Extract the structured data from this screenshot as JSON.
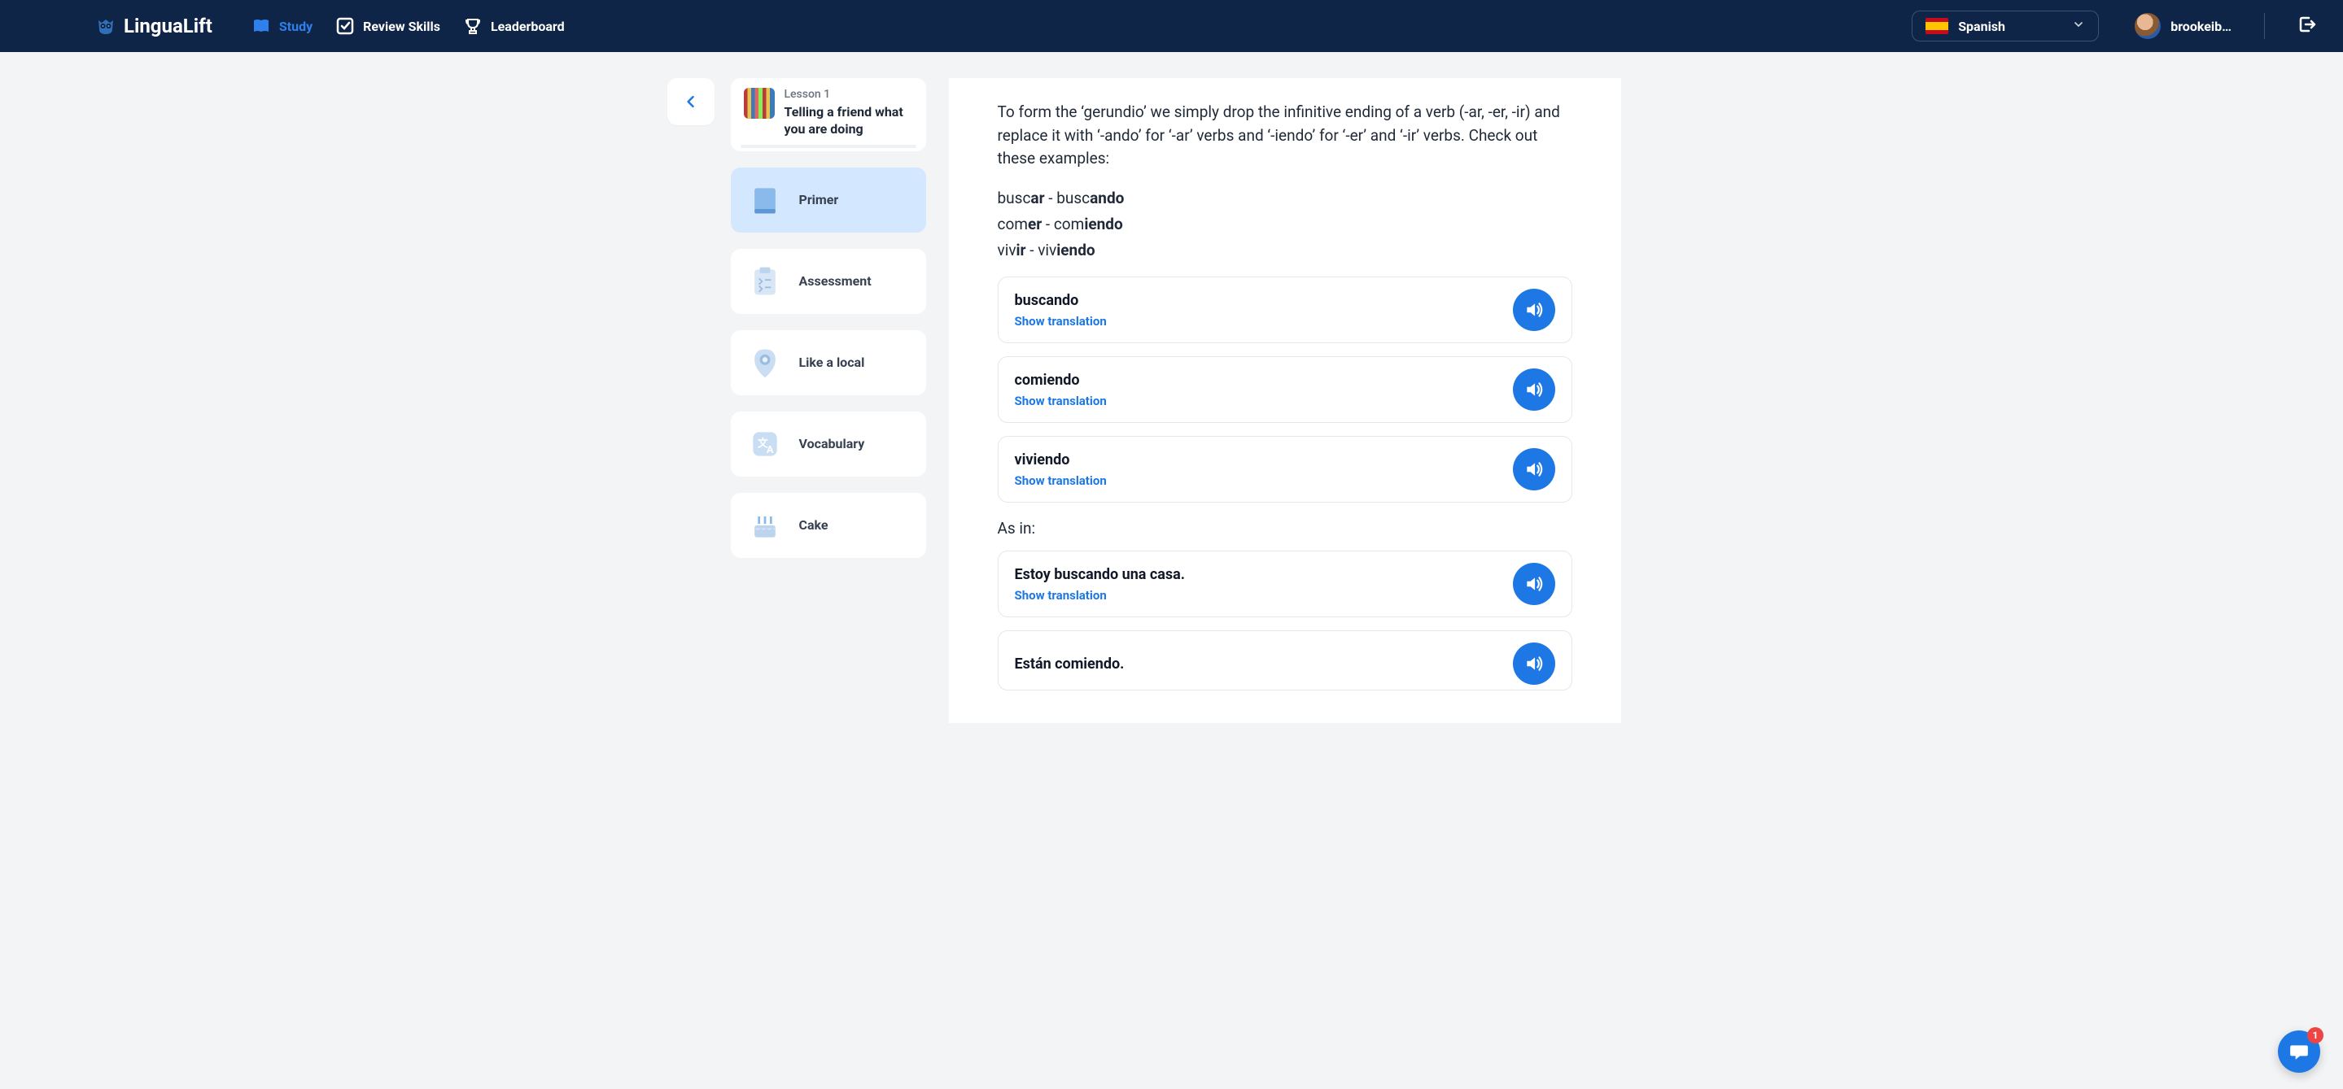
{
  "brand": {
    "name": "LinguaLift"
  },
  "nav": {
    "study": "Study",
    "review": "Review Skills",
    "leaderboard": "Leaderboard"
  },
  "language": {
    "label": "Spanish"
  },
  "user": {
    "name": "brookeib…"
  },
  "lesson": {
    "number": "Lesson 1",
    "title": "Telling a friend what you are doing"
  },
  "sidebar": {
    "primer": "Primer",
    "assessment": "Assessment",
    "likeLocal": "Like a local",
    "vocabulary": "Vocabulary",
    "cake": "Cake"
  },
  "content": {
    "intro": "To form the ‘gerundio’ we simply drop the infinitive ending of a verb (-ar, -er, -ir) and replace it with ‘-ando’ for ‘-ar’ verbs and ‘-iendo’ for ‘-er’ and ‘-ir’ verbs. Check out these examples:",
    "examples": {
      "l1": {
        "p1": "busc",
        "b1": "ar",
        "sep": " - ",
        "p2": "busc",
        "b2": "ando"
      },
      "l2": {
        "p1": "com",
        "b1": "er",
        "sep": " - ",
        "p2": "com",
        "b2": "iendo"
      },
      "l3": {
        "p1": "viv",
        "b1": "ir",
        "sep": " - ",
        "p2": "viv",
        "b2": "iendo"
      }
    },
    "showTranslation": "Show translation",
    "asIn": "As in:",
    "cards": [
      {
        "word": "buscando"
      },
      {
        "word": "comiendo"
      },
      {
        "word": "viviendo"
      }
    ],
    "sentences": [
      {
        "text": "Estoy buscando una casa."
      },
      {
        "text": "Están comiendo."
      }
    ]
  },
  "chat": {
    "badge": "1"
  }
}
